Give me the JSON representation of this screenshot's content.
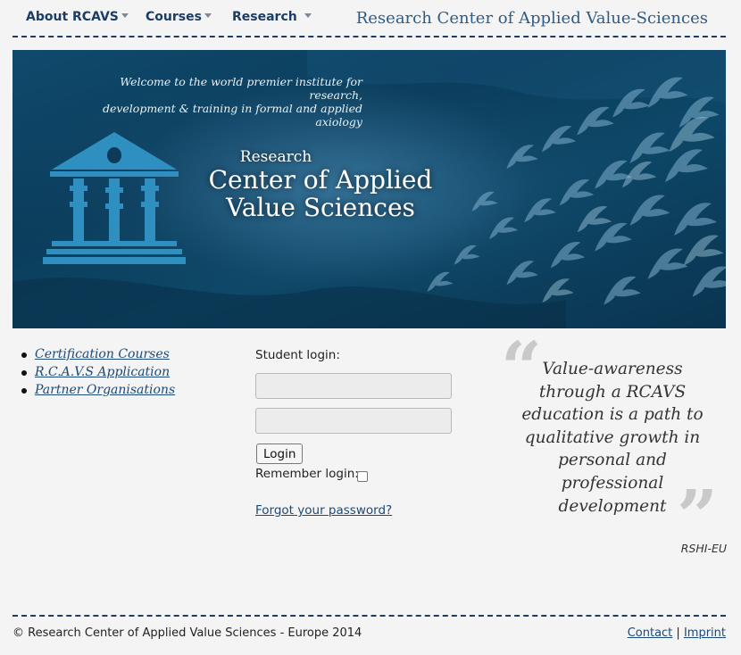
{
  "nav": {
    "items": [
      {
        "label": "About RCAVS"
      },
      {
        "label": "Courses"
      },
      {
        "label": "Research"
      }
    ],
    "site_title": "Research Center of Applied Value-Sciences"
  },
  "banner": {
    "welcome_lines": [
      "Welcome to the world premier institute for research,",
      "development & training in formal and applied axiology"
    ],
    "research_label": "Research",
    "name_lines": [
      "Center of Applied",
      "Value Sciences"
    ]
  },
  "links": [
    {
      "label": "Certification Courses"
    },
    {
      "label": "R.C.A.V.S Application"
    },
    {
      "label": "Partner Organisations"
    }
  ],
  "login": {
    "heading": "Student login:",
    "username_value": "",
    "password_value": "",
    "button_label": "Login",
    "remember_label": "Remember login:",
    "remember_checked": false,
    "forgot_label": "Forgot your password?"
  },
  "quote": {
    "open_mark": "“",
    "close_mark": "”",
    "lines": [
      "Value-awareness",
      "through a RCAVS",
      "education is a path to",
      "qualitative growth in",
      "personal and",
      "professional",
      "development"
    ],
    "author": "RSHI-EU"
  },
  "footer": {
    "copyright": "© Research Center of Applied Value Sciences - Europe 2014",
    "contact_label": "Contact",
    "separator": "|",
    "imprint_label": "Imprint"
  },
  "colors": {
    "nav_text": "#1c3d63",
    "title_text": "#2f5b86",
    "banner_dark": "#0b3d5c",
    "temple_blue": "#2f8fc0",
    "link": "#1c4a78",
    "quote_mark": "#c9c9c9"
  },
  "icons": {
    "nav_caret": "caret-down-icon",
    "logo": "temple-icon",
    "list_bullet": "bullet-icon",
    "quote_open": "open-quote-icon",
    "quote_close": "close-quote-icon"
  }
}
